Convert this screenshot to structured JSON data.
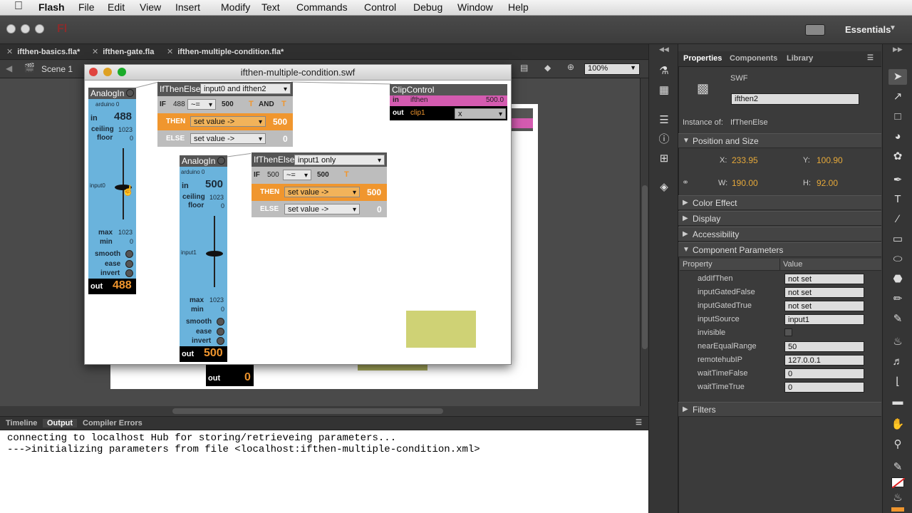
{
  "menubar": {
    "app": "Flash",
    "items": [
      "File",
      "Edit",
      "View",
      "Insert",
      "Modify",
      "Text",
      "Commands",
      "Control",
      "Debug",
      "Window",
      "Help"
    ]
  },
  "appbar": {
    "logo": "Fl",
    "workspace": "Essentials"
  },
  "doc_tabs": [
    "ifthen-basics.fla*",
    "ifthen-gate.fla",
    "ifthen-multiple-condition.fla*"
  ],
  "editbar": {
    "scene": "Scene 1",
    "zoom": "100%"
  },
  "swf": {
    "title": "ifthen-multiple-condition.swf",
    "analog0": {
      "title": "AnalogIn",
      "sub": "arduino 0",
      "in_label": "in",
      "in_val": "488",
      "ceiling_label": "ceiling",
      "ceiling": "1023",
      "floor_label": "floor",
      "floor": "0",
      "slider_label": "input0",
      "max_label": "max",
      "max": "1023",
      "min_label": "min",
      "min": "0",
      "smooth": "smooth",
      "ease": "ease",
      "invert": "invert",
      "out_label": "out",
      "out_val": "488"
    },
    "analog1": {
      "title": "AnalogIn",
      "sub": "arduino 0",
      "in_label": "in",
      "in_val": "500",
      "ceiling_label": "ceiling",
      "ceiling": "1023",
      "floor_label": "floor",
      "floor": "0",
      "slider_label": "input1",
      "max_label": "max",
      "max": "1023",
      "min_label": "min",
      "min": "0",
      "smooth": "smooth",
      "ease": "ease",
      "invert": "invert",
      "out_label": "out",
      "out_val": "500"
    },
    "ifthen0": {
      "title": "IfThenElse",
      "mode": "input0 and ifthen2",
      "if_label": "IF",
      "if_val": "488",
      "op": "~=",
      "cmp": "500",
      "t": "T",
      "and": "AND",
      "T2": "T",
      "then_label": "THEN",
      "then_sel": "set value ->",
      "then_val": "500",
      "else_label": "ELSE",
      "else_sel": "set value ->",
      "else_val": "0"
    },
    "ifthen1": {
      "title": "IfThenElse",
      "mode": "input1 only",
      "if_label": "IF",
      "if_val": "500",
      "op": "~=",
      "cmp": "500",
      "t": "T",
      "then_label": "THEN",
      "then_sel": "set value ->",
      "then_val": "500",
      "else_label": "ELSE",
      "else_sel": "set value ->",
      "else_val": "0"
    },
    "clip": {
      "title": "ClipControl",
      "in_label": "in",
      "in_name": "ifthen",
      "in_val": "500.0",
      "out_label": "out",
      "out_name": "clip1",
      "out_sel": "x"
    }
  },
  "stage_bg": {
    "out_label": "out",
    "out_val": "0"
  },
  "output_tabs": [
    "Timeline",
    "Output",
    "Compiler Errors"
  ],
  "output_lines": [
    "connecting to localhost Hub for storing/retrieveing parameters...",
    "--->initializing parameters from file <localhost:ifthen-multiple-condition.xml>"
  ],
  "properties": {
    "tabs": [
      "Properties",
      "Components",
      "Library"
    ],
    "type": "SWF",
    "instance_name": "ifthen2",
    "instance_of_label": "Instance of:",
    "instance_of": "IfThenElse",
    "pos_section": "Position and Size",
    "x_label": "X:",
    "x": "233.95",
    "y_label": "Y:",
    "y": "100.90",
    "w_label": "W:",
    "w": "190.00",
    "h_label": "H:",
    "h": "92.00",
    "sections": [
      "Color Effect",
      "Display",
      "Accessibility"
    ],
    "comp_section": "Component Parameters",
    "col_property": "Property",
    "col_value": "Value",
    "params": [
      {
        "name": "addIfThen",
        "value": "not set"
      },
      {
        "name": "inputGatedFalse",
        "value": "not set"
      },
      {
        "name": "inputGatedTrue",
        "value": "not set"
      },
      {
        "name": "inputSource",
        "value": "input1"
      },
      {
        "name": "invisible",
        "value": ""
      },
      {
        "name": "nearEqualRange",
        "value": "50"
      },
      {
        "name": "remotehubIP",
        "value": "127.0.0.1"
      },
      {
        "name": "waitTimeFalse",
        "value": "0"
      },
      {
        "name": "waitTimeTrue",
        "value": "0"
      }
    ],
    "filters": "Filters"
  },
  "colors": {
    "panel_blue": "#6ab3dc",
    "then_orange": "#f0962e",
    "clip_magenta": "#d45bb0",
    "swatch": "#cfd275",
    "value_orange": "#e6a93a"
  }
}
